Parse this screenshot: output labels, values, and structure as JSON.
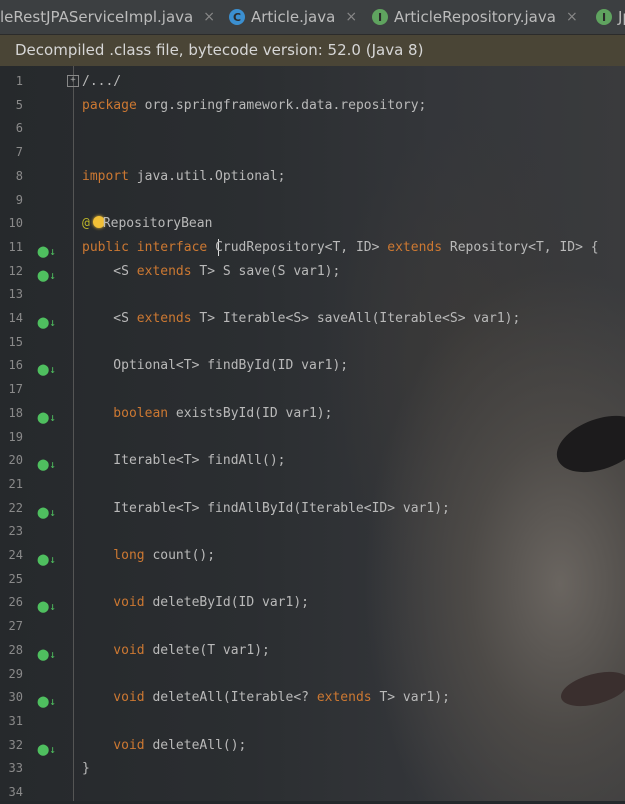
{
  "tabs": [
    {
      "label": "leRestJPAServiceImpl.java",
      "icon": "",
      "close": "×"
    },
    {
      "label": "Article.java",
      "icon": "C",
      "close": "×"
    },
    {
      "label": "ArticleRepository.java",
      "icon": "I",
      "close": "×"
    },
    {
      "label": "Jp",
      "icon": "I",
      "close": ""
    }
  ],
  "banner": "Decompiled .class file, bytecode version: 52.0 (Java 8)",
  "lines": [
    {
      "n": "1",
      "t": "/.../"
    },
    {
      "n": "5",
      "t": ""
    },
    {
      "n": "6",
      "t": ""
    },
    {
      "n": "7",
      "t": ""
    },
    {
      "n": "8",
      "t": ""
    },
    {
      "n": "9",
      "t": ""
    },
    {
      "n": "10",
      "t": ""
    },
    {
      "n": "11",
      "t": ""
    },
    {
      "n": "12",
      "t": ""
    },
    {
      "n": "13",
      "t": ""
    },
    {
      "n": "14",
      "t": ""
    },
    {
      "n": "15",
      "t": ""
    },
    {
      "n": "16",
      "t": ""
    },
    {
      "n": "17",
      "t": ""
    },
    {
      "n": "18",
      "t": ""
    },
    {
      "n": "19",
      "t": ""
    },
    {
      "n": "20",
      "t": ""
    },
    {
      "n": "21",
      "t": ""
    },
    {
      "n": "22",
      "t": ""
    },
    {
      "n": "23",
      "t": ""
    },
    {
      "n": "24",
      "t": ""
    },
    {
      "n": "25",
      "t": ""
    },
    {
      "n": "26",
      "t": ""
    },
    {
      "n": "27",
      "t": ""
    },
    {
      "n": "28",
      "t": ""
    },
    {
      "n": "29",
      "t": ""
    },
    {
      "n": "30",
      "t": ""
    },
    {
      "n": "31",
      "t": ""
    },
    {
      "n": "32",
      "t": ""
    },
    {
      "n": "33",
      "t": ""
    },
    {
      "n": "34",
      "t": ""
    }
  ],
  "code": {
    "l5": {
      "kw": "package",
      "rest": " org.springframework.data.repository;"
    },
    "l8": {
      "kw": "import",
      "rest": " java.util.Optional;"
    },
    "l10": {
      "at": "@",
      "rest": "RepositoryBean"
    },
    "l11": {
      "kw1": "public",
      "kw2": " interface",
      "name": " CrudRepository<T, ID>",
      "kw3": " extends",
      "rest": " Repository<T, ID> {"
    },
    "l12": {
      "a": "    <S",
      "kw": " extends",
      "rest": " T> S save(S var1);"
    },
    "l14": {
      "a": "    <S",
      "kw": " extends",
      "rest": " T> Iterable<S> saveAll(Iterable<S> var1);"
    },
    "l16": {
      "rest": "    Optional<T> findById(ID var1);"
    },
    "l18": {
      "kw": "    boolean",
      "rest": " existsById(ID var1);"
    },
    "l20": {
      "rest": "    Iterable<T> findAll();"
    },
    "l22": {
      "rest": "    Iterable<T> findAllById(Iterable<ID> var1);"
    },
    "l24": {
      "kw": "    long",
      "rest": " count();"
    },
    "l26": {
      "kw": "    void",
      "rest": " deleteById(ID var1);"
    },
    "l28": {
      "kw": "    void",
      "rest": " delete(T var1);"
    },
    "l30": {
      "kw": "    void",
      "a": " deleteAll(Iterable<?",
      "kw2": " extends",
      "rest": " T> var1);"
    },
    "l32": {
      "kw": "    void",
      "rest": " deleteAll();"
    },
    "l33": {
      "rest": "}"
    }
  },
  "gutter_mark": "⬤↓",
  "colors": {
    "keyword": "#cc7832",
    "text": "#b9b9b9",
    "banner": "#4a4536",
    "mark": "#4fbf5f"
  }
}
